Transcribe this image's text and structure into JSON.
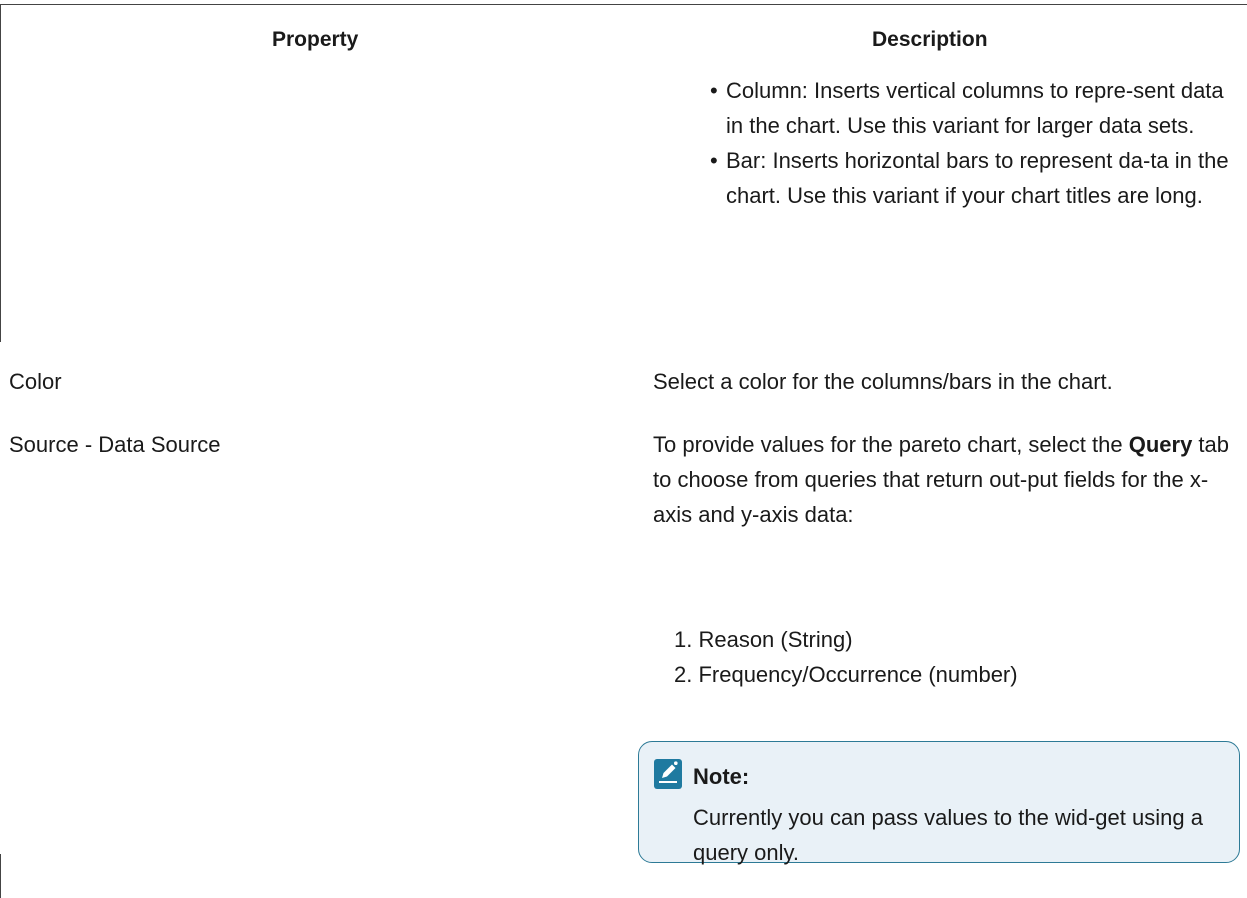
{
  "table": {
    "headers": {
      "property": "Property",
      "description": "Description"
    },
    "variant_items": [
      "Column: Inserts vertical columns to repre-sent data in the chart. Use this variant for larger data sets.",
      "Bar: Inserts horizontal bars to represent da-ta in the chart. Use this variant if your chart titles are long."
    ],
    "rows": [
      {
        "property": "Color",
        "description": "Select a color for the columns/bars in the chart."
      },
      {
        "property": "Source - Data Source"
      }
    ],
    "source": {
      "desc_pre": "To provide values for the pareto chart, select the ",
      "desc_bold": "Query",
      "desc_post": " tab to choose from queries that return out-put fields for the x-axis and y-axis data:",
      "fields": [
        "1. Reason (String)",
        "2. Frequency/Occurrence (number)"
      ],
      "note": {
        "icon": "note-pencil-icon",
        "title": "Note:",
        "body": "Currently you can pass values to the wid-get using a query only."
      }
    }
  },
  "colors": {
    "note_border": "#2d7a96",
    "note_bg": "#e9f1f7",
    "icon_bg": "#1f7aa0"
  }
}
